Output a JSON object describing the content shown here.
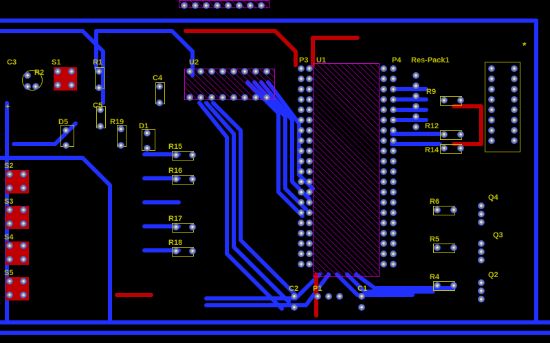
{
  "designators": {
    "C3": "C3",
    "R2": "R2",
    "S1": "S1",
    "R1": "R1",
    "U2": "U2",
    "P3": "P3",
    "U1": "U1",
    "P4": "P4",
    "RP1": "Res-Pack1",
    "C4": "C4",
    "R9": "R9",
    "C5": "C5",
    "R19": "R19",
    "D5": "D5",
    "D1": "D1",
    "R15": "R15",
    "R12": "R12",
    "R14": "R14",
    "R16": "R16",
    "S2": "S2",
    "S3": "S3",
    "S4": "S4",
    "S5": "S5",
    "R17": "R17",
    "R18": "R18",
    "C2": "C2",
    "P1": "P1",
    "C1": "C1",
    "R6": "R6",
    "R5": "R5",
    "R4": "R4",
    "Q4": "Q4",
    "Q3": "Q3",
    "Q2": "Q2",
    "plus": "+",
    "star": "*"
  },
  "layout": {
    "board_size": "800x500",
    "layers": [
      "top-copper-blue",
      "bottom-copper-red",
      "silk-yellow",
      "silk-magenta"
    ],
    "components": [
      {
        "ref": "U1",
        "type": "DIP-40",
        "pins": 40
      },
      {
        "ref": "U2",
        "type": "DIP-16",
        "pins": 16
      },
      {
        "ref": "S1",
        "type": "tact-switch"
      },
      {
        "ref": "S2",
        "type": "tact-switch"
      },
      {
        "ref": "S3",
        "type": "tact-switch"
      },
      {
        "ref": "S4",
        "type": "tact-switch"
      },
      {
        "ref": "S5",
        "type": "tact-switch"
      },
      {
        "ref": "R2",
        "type": "pot"
      },
      {
        "ref": "C3",
        "type": "cap"
      },
      {
        "ref": "Res-Pack1",
        "type": "SIP-resistor-pack"
      },
      {
        "ref": "P3",
        "type": "header"
      },
      {
        "ref": "P4",
        "type": "header"
      }
    ]
  }
}
